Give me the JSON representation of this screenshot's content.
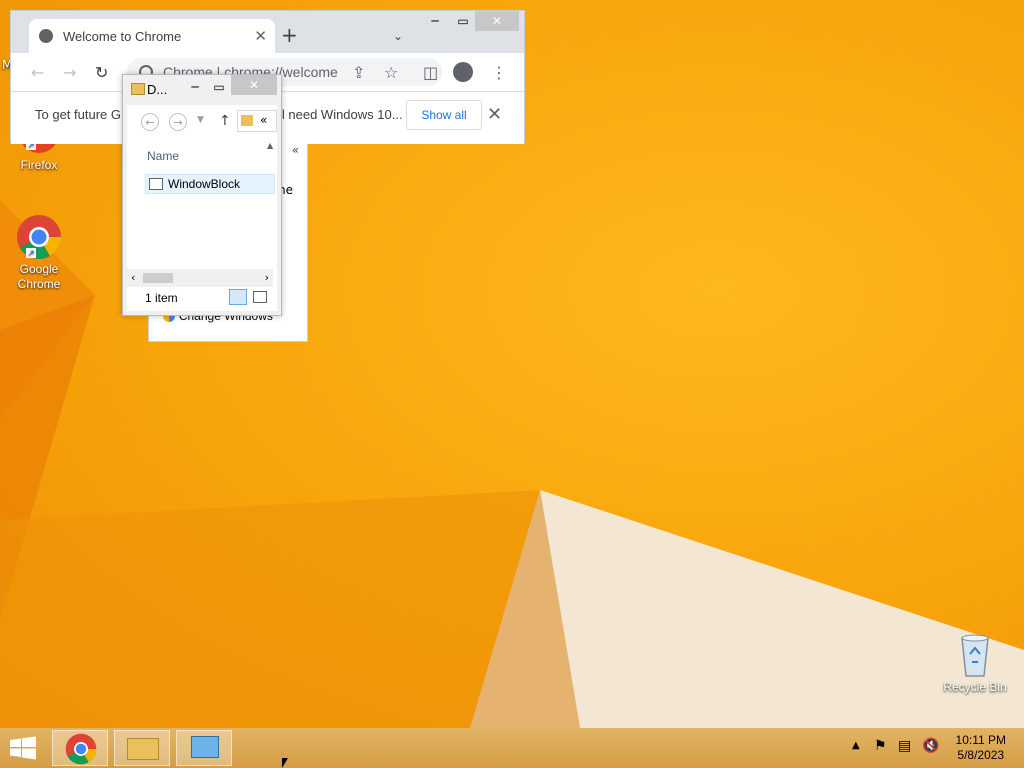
{
  "desktop": {
    "icons": [
      {
        "label": "Firefox"
      },
      {
        "label": "Google Chrome"
      },
      {
        "label": "Recycle Bin"
      }
    ],
    "partial_left_letter": "M"
  },
  "chrome": {
    "tab_title": "Welcome to Chrome",
    "tab_close": "✕",
    "new_tab": "+",
    "tab_search": "⌄",
    "omnibox_text": "Chrome  |  chrome://welcome",
    "infobar_text": "To get future Google Chrome updates, you'll need Windows 10...",
    "infobar_visible_left": "To get future G",
    "infobar_visible_right": "ll need Windows 10...",
    "show_all": "Show all",
    "close_glyph": "✕"
  },
  "explorer": {
    "title": "D...",
    "column_header": "Name",
    "items": [
      {
        "name": "WindowBlock"
      }
    ],
    "status": "1 item",
    "collapse": "«"
  },
  "background_window": {
    "collapse": "«",
    "partial_text_1": "ne",
    "partial_text_2": "Change Windows"
  },
  "taskbar": {
    "time": "10:11 PM",
    "date": "5/8/2023"
  }
}
